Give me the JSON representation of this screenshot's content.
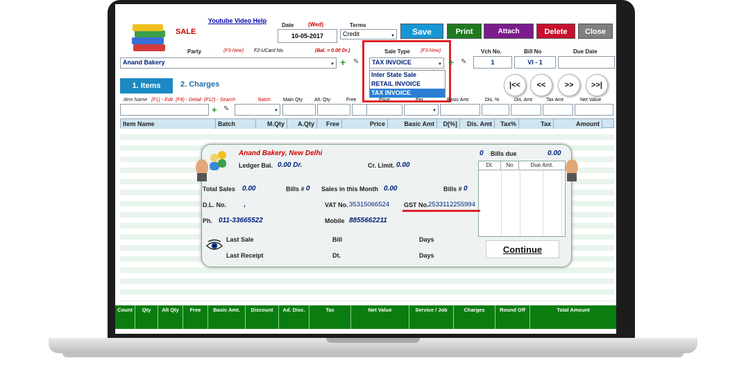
{
  "header": {
    "title": "SALE",
    "help_link": "Youtube Video Help",
    "date_label": "Date",
    "day": "(Wed)",
    "date_value": "10-05-2017",
    "terms_label": "Terms",
    "terms_value": "Credit"
  },
  "toolbar": {
    "save": "Save",
    "print": "Print",
    "attach": "Attach",
    "delete": "Delete",
    "close": "Close"
  },
  "party": {
    "label": "Party",
    "f3_hint": "{F3-New}",
    "f2_hint": "F2-UCard No.",
    "balance_hint": "(Bal. = 0.00 Dr.)",
    "value": "Anand Bakery"
  },
  "sale_type": {
    "label": "Sale Type",
    "f3_hint": "{F3-New}",
    "value": "TAX INVOICE",
    "options": [
      "Inter State Sale",
      "RETAIL INVOICE",
      "TAX INVOICE"
    ],
    "selected_index": 2
  },
  "voucher": {
    "vch_label": "Vch No.",
    "vch_value": "1",
    "bill_label": "Bill No",
    "bill_value": "VI - 1",
    "due_label": "Due Date",
    "due_value": ""
  },
  "tabs": {
    "items": "1. Items",
    "charges": "2. Charges"
  },
  "nav": {
    "first": "|<<",
    "prev": "<<",
    "next": ">>",
    "last": ">>|"
  },
  "entry_labels": {
    "item_name": "Item Name",
    "item_hints": "{F1} - Edit  {F8} - Detail  {F12} - Search",
    "batch": "Batch",
    "main_qty": "Main Qty",
    "alt_qty": "Alt. Qty",
    "free": "Free",
    "price": "Price",
    "per": "Per",
    "basic_amt": "Basic Amt",
    "dis_pct": "Dis. %",
    "dis_amt": "Dis. Amt",
    "tax_amt": "Tax Amt",
    "net_value": "Net Value"
  },
  "grid_headers": [
    "Item Name",
    "Batch",
    "M.Qty",
    "A.Qty",
    "Free",
    "Price",
    "Basic Amt",
    "D[%]",
    "Dis. Amt",
    "Tax%",
    "Tax",
    "Amount"
  ],
  "popup": {
    "party_title": "Anand Bakery, New Delhi",
    "bills_due_count": "0",
    "bills_due_label": "Bills due",
    "bills_due_amount": "0.00",
    "ledger_label": "Ledger Bal.",
    "ledger_value": "0.00 Dr.",
    "cr_limit_label": "Cr. Limit.",
    "cr_limit_value": "0.00",
    "due_table_headers": [
      "Dt.",
      "No",
      "Due Amt."
    ],
    "total_sales_label": "Total Sales",
    "total_sales_value": "0.00",
    "bills_label": "Bills #",
    "bills_value": "0",
    "month_sales_label": "Sales in this Month",
    "month_sales_value": "0.00",
    "month_bills_label": "Bills #",
    "month_bills_value": "0",
    "dl_label": "D.L. No.",
    "dl_value": ",",
    "vat_label": "VAT No.",
    "vat_value": "35315066524",
    "gst_label": "GST No.",
    "gst_value": "2533112255994",
    "phone_label": "Ph.",
    "phone_value": "011-33665522",
    "mobile_label": "Mobile",
    "mobile_value": "8855662211",
    "last_sale_label": "Last Sale",
    "last_receipt_label": "Last Receipt",
    "bill_label": "Bill",
    "dt_label": "Dt.",
    "days_label_1": "Days",
    "days_label_2": "Days",
    "continue": "Continue"
  },
  "footer": [
    "Count",
    "Qty",
    "Alt Qty",
    "Free",
    "Basic Amt.",
    "Discount",
    "Ad. Disc.",
    "Tax",
    "Net Value",
    "Service / Job",
    "Charges",
    "Round Off",
    "Total Amount"
  ],
  "colors": {
    "save": "#1796d6",
    "print": "#1e7a1e",
    "attach": "#7b1c8c",
    "delete": "#c8102e",
    "close": "#7f7f7f",
    "footer": "#0b7d10",
    "highlight": "#e1222b"
  }
}
